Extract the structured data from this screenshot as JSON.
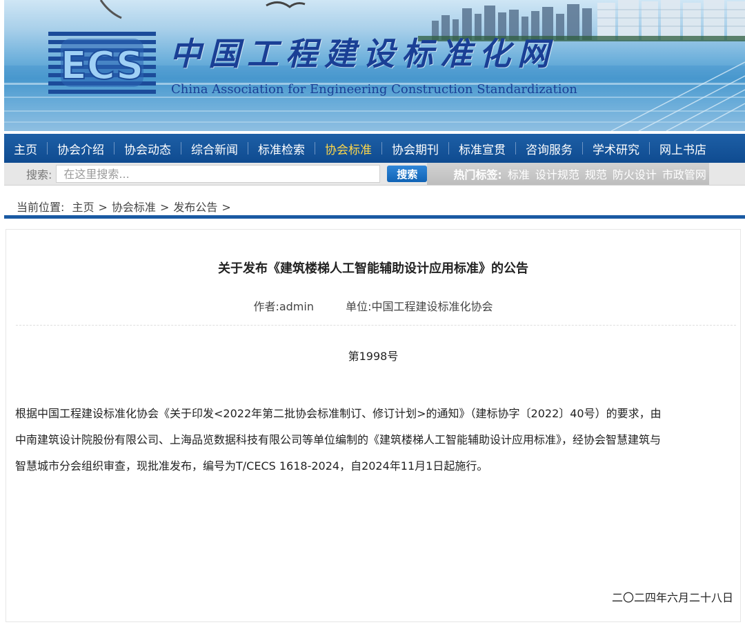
{
  "header": {
    "logo_text": "ECS",
    "title_cn": "中国工程建设标准化网",
    "title_en": "China Association for Engineering Construction Standardization"
  },
  "nav": {
    "items": [
      {
        "label": "主页"
      },
      {
        "label": "协会介绍"
      },
      {
        "label": "协会动态"
      },
      {
        "label": "综合新闻"
      },
      {
        "label": "标准检索"
      },
      {
        "label": "协会标准",
        "active": true
      },
      {
        "label": "协会期刊"
      },
      {
        "label": "标准宣贯"
      },
      {
        "label": "咨询服务"
      },
      {
        "label": "学术研究"
      },
      {
        "label": "网上书店"
      }
    ],
    "active_color": "#ffd84a",
    "background": "#1d5fa6"
  },
  "search": {
    "label": "搜索:",
    "placeholder": "在这里搜索...",
    "button": "搜索",
    "hot_label": "热门标签:",
    "hot_tags": [
      "标准",
      "设计规范",
      "规范",
      "防火设计",
      "市政管网"
    ]
  },
  "breadcrumb": {
    "prefix": "当前位置:",
    "items": [
      "主页",
      "协会标准",
      "发布公告"
    ],
    "separator": ">"
  },
  "article": {
    "title": "关于发布《建筑楼梯人工智能辅助设计应用标准》的公告",
    "author": "作者:admin",
    "unit": "单位:中国工程建设标准化协会",
    "doc_no": "第1998号",
    "body_lines": [
      "根据中国工程建设标准化协会《关于印发<2022年第二批协会标准制订、修订计划>的通知》（建标协字〔2022〕40号）的要求，由",
      "中南建筑设计院股份有限公司、上海品览数据科技有限公司等单位编制的《建筑楼梯人工智能辅助设计应用标准》，经协会智慧建筑与",
      "智慧城市分会组织审查，现批准发布，编号为T/CECS 1618-2024，自2024年11月1日起施行。"
    ],
    "date": "二〇二四年六月二十八日"
  }
}
